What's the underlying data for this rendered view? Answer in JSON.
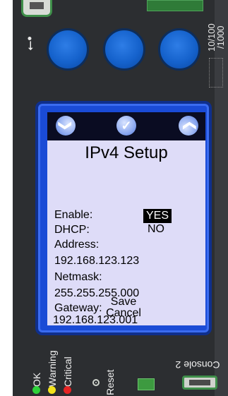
{
  "device": {
    "speed_label": "10/100\n/1000",
    "usb_symbol": "⭘→"
  },
  "nav": {
    "left_icon": "❯",
    "middle_icon": "✓",
    "right_icon": "❯"
  },
  "screen": {
    "title": "IPv4 Setup",
    "enable_label": "Enable:",
    "enable_yes": "YES",
    "dhcp_label": "DHCP:",
    "dhcp_no": "NO",
    "address_label": "Address:",
    "address_value": "192.168.123.123",
    "netmask_label": "Netmask:",
    "netmask_value": "255.255.255.000",
    "gateway_label": "Gateway:",
    "gateway_value": "192.168.123.001",
    "save_label": "Save",
    "cancel_label": "Cancel"
  },
  "status": {
    "ok_label": "OK",
    "warning_label": "Warning",
    "critical_label": "Critical",
    "ok_color": "#2ed23a",
    "warning_color": "#f2e21c",
    "critical_color": "#e62424"
  },
  "reset_label": "Reset",
  "console_label": "Console 2"
}
